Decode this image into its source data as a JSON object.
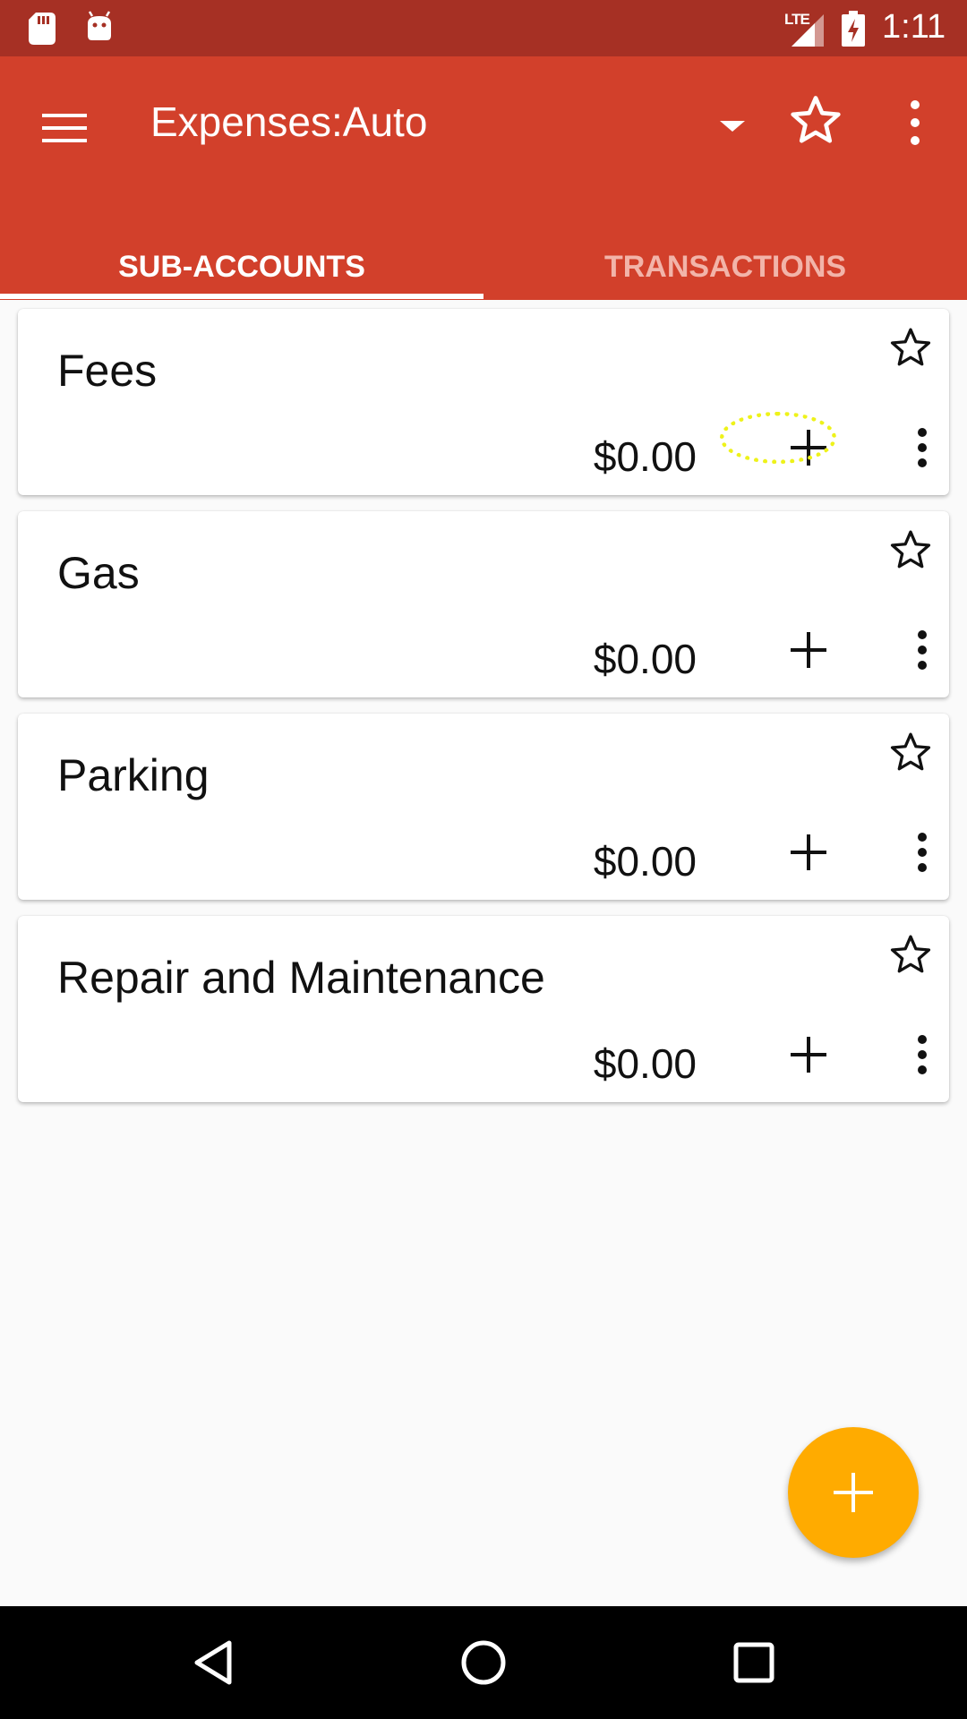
{
  "status_bar": {
    "network": "LTE",
    "time": "1:11",
    "icons": [
      "sd-card-icon",
      "android-icon",
      "signal-icon",
      "battery-charging-icon"
    ]
  },
  "toolbar": {
    "title": "Expenses:Auto",
    "icons": [
      "menu-icon",
      "dropdown-caret-icon",
      "star-outline-icon",
      "overflow-menu-icon"
    ]
  },
  "tabs": [
    {
      "label": "SUB-ACCOUNTS",
      "selected": true
    },
    {
      "label": "TRANSACTIONS",
      "selected": false
    }
  ],
  "accounts": [
    {
      "name": "Fees",
      "balance": "$0.00"
    },
    {
      "name": "Gas",
      "balance": "$0.00"
    },
    {
      "name": "Parking",
      "balance": "$0.00"
    },
    {
      "name": "Repair and Maintenance",
      "balance": "$0.00"
    }
  ],
  "fab": {
    "icon": "plus-icon",
    "color": "#ffab00"
  },
  "colors": {
    "status_bar": "#a63024",
    "toolbar": "#d2402b",
    "accent": "#ffab00",
    "inactive_tab": "#f2b4a9"
  },
  "nav_bar": {
    "icons": [
      "back-icon",
      "home-icon",
      "recents-icon"
    ]
  }
}
